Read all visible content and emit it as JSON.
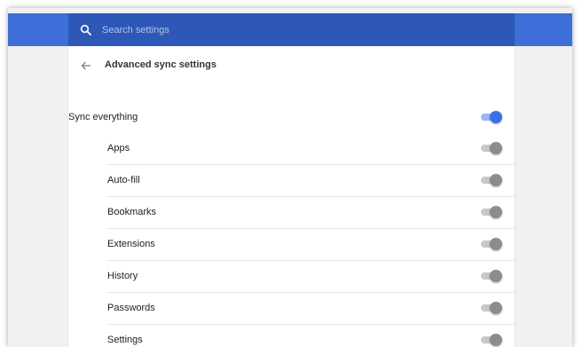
{
  "search": {
    "placeholder": "Search settings"
  },
  "subpage": {
    "title": "Advanced sync settings"
  },
  "sync_everything": {
    "label": "Sync everything",
    "enabled": true
  },
  "sync_items": [
    {
      "label": "Apps",
      "enabled": false
    },
    {
      "label": "Auto-fill",
      "enabled": false
    },
    {
      "label": "Bookmarks",
      "enabled": false
    },
    {
      "label": "Extensions",
      "enabled": false
    },
    {
      "label": "History",
      "enabled": false
    },
    {
      "label": "Passwords",
      "enabled": false
    },
    {
      "label": "Settings",
      "enabled": false
    }
  ],
  "icons": {
    "search": "search-icon",
    "back": "arrow-left-icon"
  },
  "colors": {
    "header": "#3e6fd8",
    "search_bg": "#2d58b8",
    "toggle_on": "#3a72e6",
    "toggle_off": "#8c8c8c"
  }
}
